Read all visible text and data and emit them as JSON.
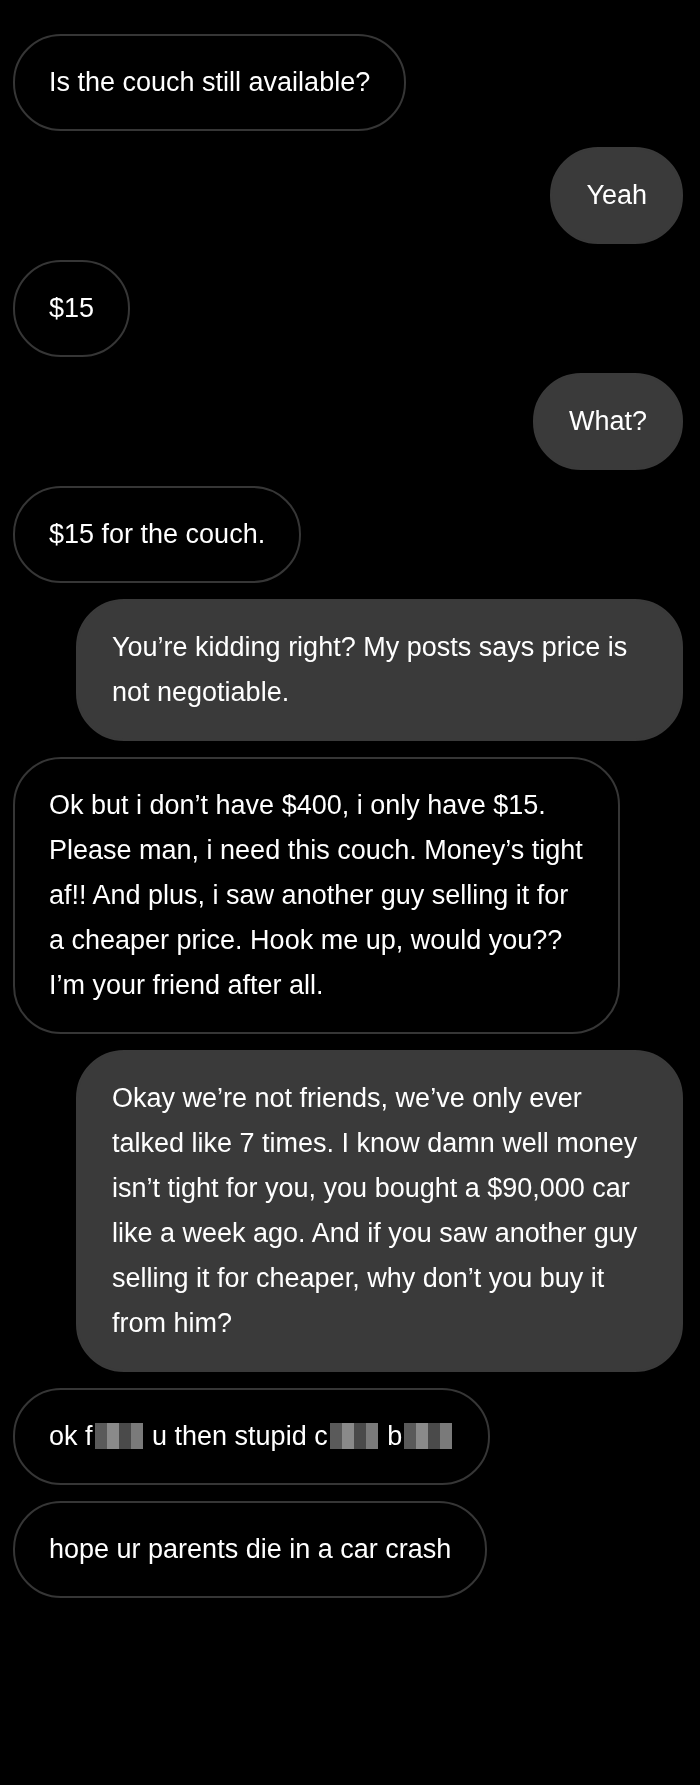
{
  "messages": [
    {
      "kind": "received",
      "segments": [
        {
          "kind": "text",
          "text": "Is the couch still available?"
        }
      ]
    },
    {
      "kind": "sent",
      "segments": [
        {
          "kind": "text",
          "text": "Yeah"
        }
      ]
    },
    {
      "kind": "received",
      "segments": [
        {
          "kind": "text",
          "text": "$15"
        }
      ]
    },
    {
      "kind": "sent",
      "segments": [
        {
          "kind": "text",
          "text": "What?"
        }
      ]
    },
    {
      "kind": "received",
      "segments": [
        {
          "kind": "text",
          "text": "$15 for the couch."
        }
      ]
    },
    {
      "kind": "sent",
      "segments": [
        {
          "kind": "text",
          "text": "You’re kidding right? My posts says price is not negotiable."
        }
      ]
    },
    {
      "kind": "received",
      "segments": [
        {
          "kind": "text",
          "text": "Ok but i don’t have $400, i only have $15. Please man, i need this couch. Money’s tight af!! And plus, i saw another guy selling it for a cheaper price. Hook me up, would you?? I’m your friend after all."
        }
      ]
    },
    {
      "kind": "sent",
      "segments": [
        {
          "kind": "text",
          "text": "Okay we’re not friends, we’ve only ever talked like 7 times. I know damn well money isn’t tight for you, you bought a $90,000 car like a week ago. And if you saw another guy selling it for cheaper, why don’t you buy it from him?"
        }
      ]
    },
    {
      "kind": "received",
      "segments": [
        {
          "kind": "text",
          "text": "ok f"
        },
        {
          "kind": "censored"
        },
        {
          "kind": "text",
          "text": " u then stupid c"
        },
        {
          "kind": "censored"
        },
        {
          "kind": "text",
          "text": " b"
        },
        {
          "kind": "censored"
        }
      ]
    },
    {
      "kind": "received",
      "segments": [
        {
          "kind": "text",
          "text": "hope ur parents die in a car crash"
        }
      ]
    }
  ]
}
